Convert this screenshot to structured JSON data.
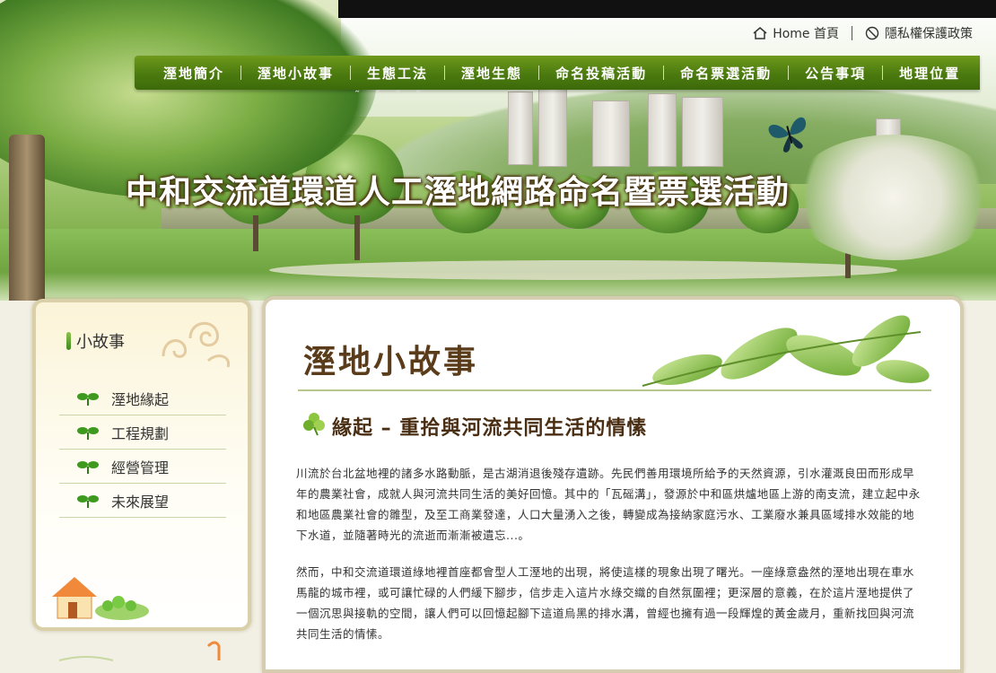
{
  "banner": {
    "title": "中和交流道環道人工溼地網路命名暨票選活動"
  },
  "top_links": {
    "home": "Home 首頁",
    "privacy": "隱私權保護政策"
  },
  "nav": {
    "items": [
      "溼地簡介",
      "溼地小故事",
      "生態工法",
      "溼地生態",
      "命名投稿活動",
      "命名票選活動",
      "公告事項",
      "地理位置"
    ]
  },
  "sidebar": {
    "heading": "小故事",
    "items": [
      "溼地緣起",
      "工程規劃",
      "經營管理",
      "未來展望"
    ]
  },
  "content": {
    "title": "溼地小故事",
    "subtitle": "緣起 – 重拾與河流共同生活的情愫",
    "paragraphs": [
      "川流於台北盆地裡的諸多水路動脈，是古湖消退後殘存遺跡。先民們善用環境所給予的天然資源，引水灌溉良田而形成早年的農業社會，成就人與河流共同生活的美好回憶。其中的「瓦磘溝」，發源於中和區烘爐地區上游的南支流，建立起中永和地區農業社會的雛型，及至工商業發達，人口大量湧入之後，轉變成為接納家庭污水、工業廢水兼具區域排水效能的地下水道，並隨著時光的流逝而漸漸被遺忘...。",
      "然而，中和交流道環道綠地裡首座都會型人工溼地的出現，將使這樣的現象出現了曙光。一座綠意盎然的溼地出現在車水馬龍的城市裡，或可讓忙碌的人們緩下腳步，信步走入這片水綠交織的自然氛圍裡；更深層的意義，在於這片溼地提供了一個沉思與接軌的空間，讓人們可以回憶起腳下這道烏黑的排水溝，曾經也擁有過一段輝煌的黃金歲月，重新找回與河流共同生活的情愫。"
    ]
  },
  "colors": {
    "nav_green": "#4b7a0f",
    "title_brown": "#5a3b1a",
    "border": "#d6ccb0"
  }
}
